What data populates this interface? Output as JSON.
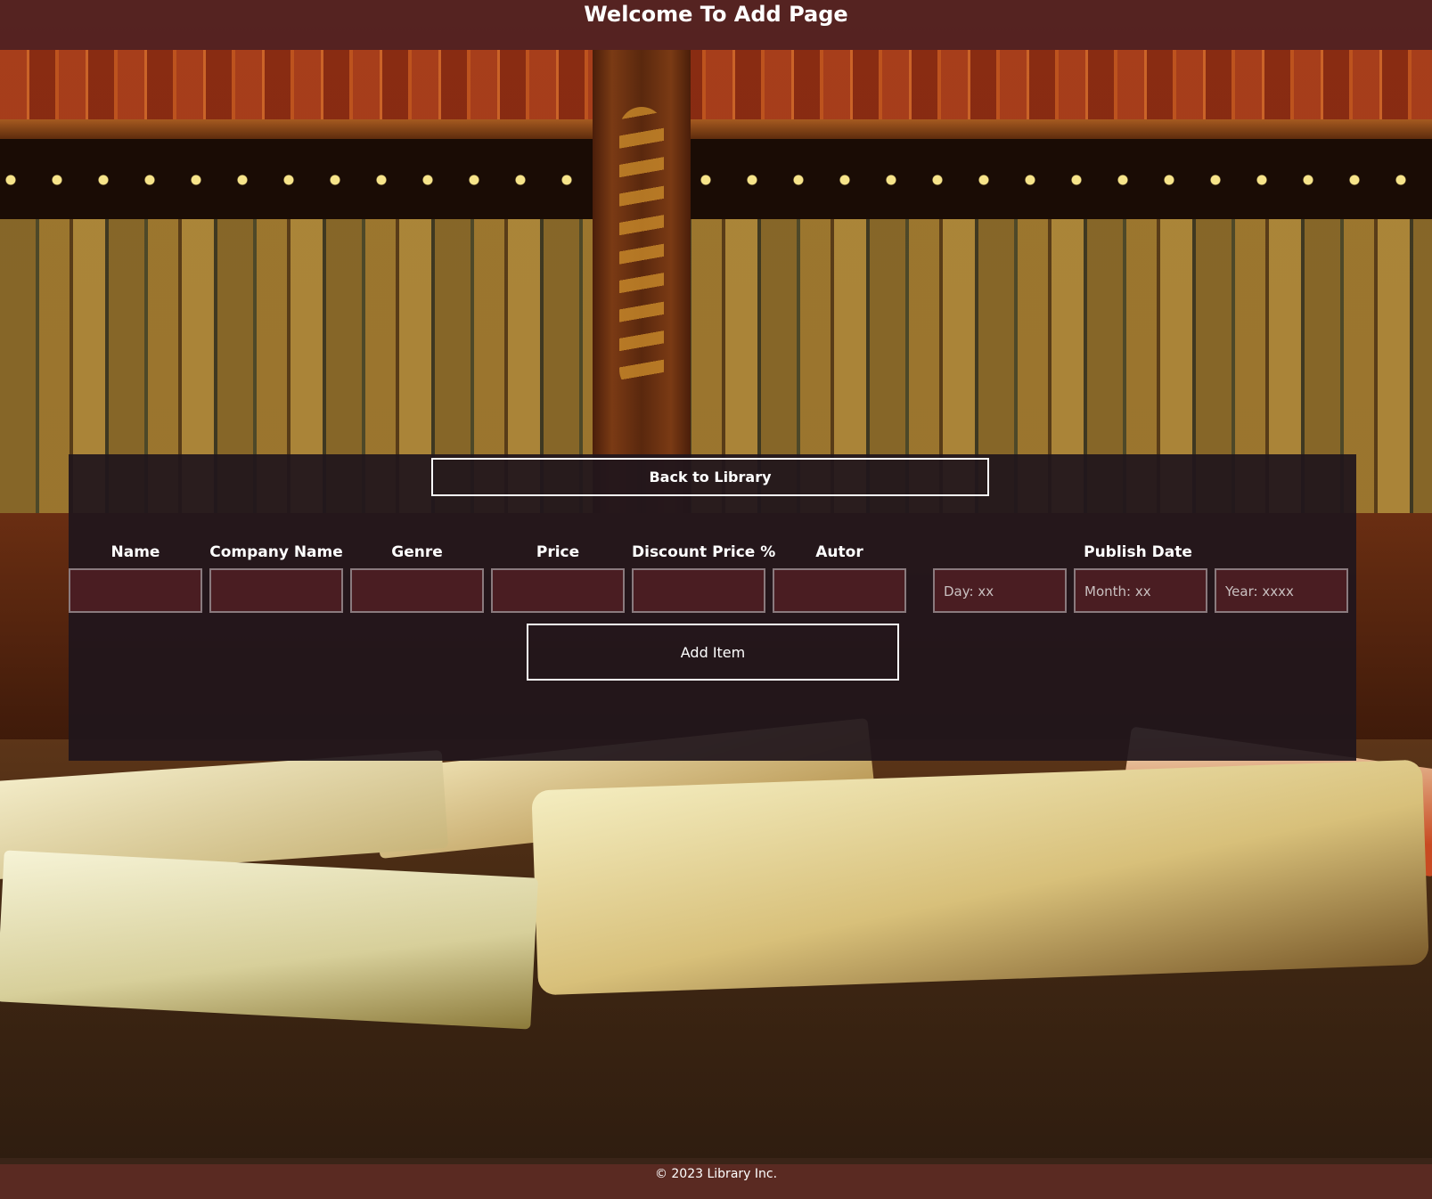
{
  "header": {
    "title": "Welcome To Add Page"
  },
  "panel": {
    "back_button": "Back to Library",
    "fields": [
      {
        "label": "Name",
        "placeholder": ""
      },
      {
        "label": "Company Name",
        "placeholder": ""
      },
      {
        "label": "Genre",
        "placeholder": ""
      },
      {
        "label": "Price",
        "placeholder": ""
      },
      {
        "label": "Discount Price %",
        "placeholder": ""
      },
      {
        "label": "Autor",
        "placeholder": ""
      }
    ],
    "publish_date": {
      "label": "Publish Date",
      "day_placeholder": "Day: xx",
      "month_placeholder": "Month: xx",
      "year_placeholder": "Year: xxxx"
    },
    "add_button": "Add Item"
  },
  "footer": {
    "text": "© 2023 Library Inc."
  },
  "colors": {
    "header_bg": "#552222",
    "panel_bg": "#20161c",
    "input_bg": "#4a1d22",
    "footer_bg": "#5a2a22"
  }
}
